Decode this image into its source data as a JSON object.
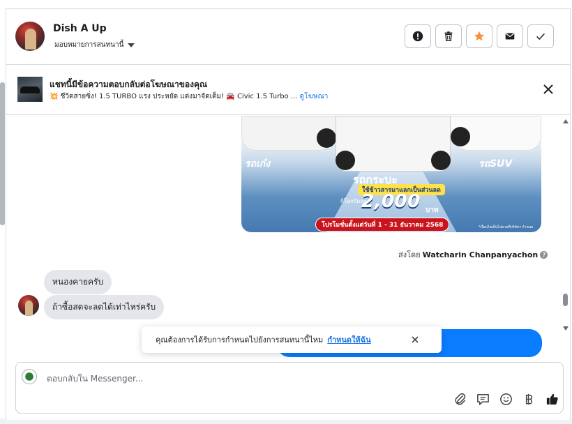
{
  "header": {
    "contact_name": "Dish A Up",
    "assign_label": "มอบหมายการสนทนานี้",
    "actions": [
      {
        "icon": "alert-icon",
        "label": "spam"
      },
      {
        "icon": "trash-icon",
        "label": "delete"
      },
      {
        "icon": "star-icon",
        "label": "follow-up"
      },
      {
        "icon": "mail-icon",
        "label": "mark-unread"
      },
      {
        "icon": "check-icon",
        "label": "done"
      }
    ],
    "star_color": "#f7923a"
  },
  "ad_banner": {
    "title": "แชทนี้มีข้อความตอบกลับต่อโฆษณาของคุณ",
    "subtitle": "💥 ชีวิตสายซิ่ง! 1.5 TURBO แรง ประหยัด แต่งมาจัดเต็ม! 🚘 Civic 1.5 Turbo ...",
    "link_text": "ดูโฆษณา"
  },
  "promo_image": {
    "label_left": "รถเก๋ง",
    "label_center": "รถกระบะ",
    "label_right": "รถSUV",
    "tag_text": "ใช้ข้าวสารมาแลกเป็นส่วนลด",
    "unit_text": "กิโลกรัมละ",
    "amount": "2,000",
    "currency": "บาท",
    "period": "โปรโมชั่นตั้งแต่วันที่ 1 - 31 ธันวาคม 2568",
    "fine_print": "*เงื่อนไขเป็นไปตามที่บริษัทฯ กำหนด"
  },
  "sent_by": {
    "prefix": "ส่งโดย",
    "name": "Watcharin Chanpanyachon"
  },
  "messages": [
    {
      "text": "หนองคายครับ"
    },
    {
      "text": "ถ้าซื้อสดจะลดได้เท่าไหร่ครับ"
    }
  ],
  "reminder": {
    "text": "คุณต้องการได้รับการกำหนดไปยังการสนทนานี้ไหม",
    "cta": "กำหนดให้ฉัน"
  },
  "composer": {
    "placeholder": "ตอบกลับใน Messenger..."
  },
  "colors": {
    "accent": "#1b74e4",
    "bubble_gray": "#e4e6eb",
    "bubble_blue": "#0a7cff"
  }
}
